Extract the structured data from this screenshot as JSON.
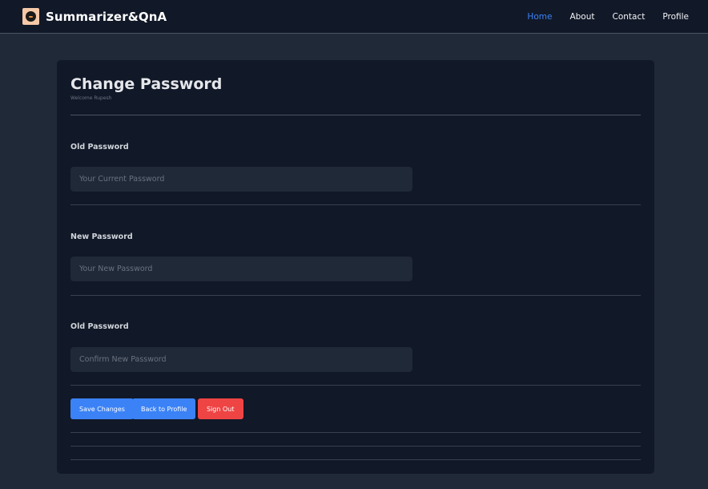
{
  "brand": {
    "name": "Summarizer&QnA"
  },
  "nav": {
    "home": "Home",
    "about": "About",
    "contact": "Contact",
    "profile": "Profile"
  },
  "form": {
    "title": "Change Password",
    "subtitle": "Welcome Rupesh",
    "fields": [
      {
        "label": "Old Password",
        "value": "",
        "placeholder": "Your Current Password"
      },
      {
        "label": "New Password",
        "value": "",
        "placeholder": "Your New Password"
      },
      {
        "label": "Old Password",
        "value": "",
        "placeholder": "Confirm New Password"
      }
    ],
    "buttons": {
      "save": "Save Changes",
      "back": "Back to Profile",
      "signout": "Sign Out"
    }
  },
  "colors": {
    "page_bg": "#1f2937",
    "card_bg": "#111827",
    "accent": "#3b82f6",
    "danger": "#ef4444"
  }
}
